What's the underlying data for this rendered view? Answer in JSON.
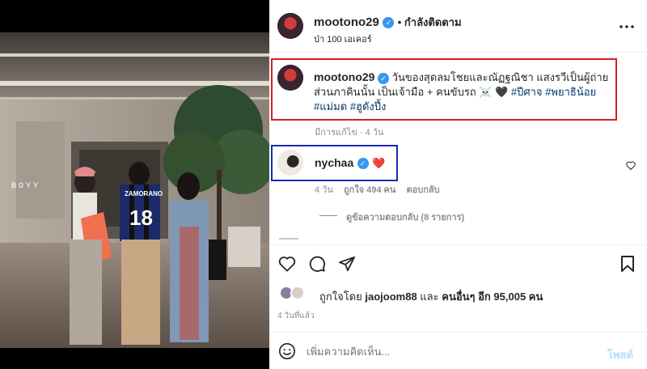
{
  "post": {
    "author": "mootono29",
    "follow_status": "• กำลังติดตาม",
    "location": "ป่า 100 เอเคอร์",
    "more_icon": "more-horizontal-icon",
    "watermark_left": "BOYY",
    "jersey_name": "ZAMORANO",
    "jersey_number": "18"
  },
  "caption": {
    "author": "mootono29",
    "text_before": "วันของสุดลมโชยและณัฏฐณิชา แสงรวีเป็นผู้ถ่ายส่วนภาคินนั้น เป็นเจ้ามือ + คนขับรถ ☠️ 🖤",
    "hashtags": [
      "#ปีศาจ",
      "#พยาธิน้อย",
      "#แม่มด",
      "#ฮูดังปึ้ง"
    ],
    "edited": "มีการแก้ไข · 4 วัน"
  },
  "comment": {
    "author": "nychaa",
    "text": "❤️",
    "time": "4 วัน",
    "likes": "ถูกใจ 494 คน",
    "reply": "ตอบกลับ",
    "view_replies": "ดูข้อความตอบกลับ (8 รายการ)"
  },
  "actions": {
    "like_icon": "heart-icon",
    "comment_icon": "comment-icon",
    "share_icon": "send-icon",
    "save_icon": "bookmark-icon"
  },
  "likes": {
    "prefix": "ถูกใจโดย",
    "user": "jaojoom88",
    "middle": "และ",
    "others": "คนอื่นๆ อีก 95,005 คน",
    "time": "4 วันที่แล้ว"
  },
  "composer": {
    "placeholder": "เพิ่มความคิดเห็น...",
    "post_label": "โพสต์",
    "emoji_icon": "emoji-icon"
  },
  "colors": {
    "verified": "#3897f0",
    "hashtag": "#00376b",
    "red_box": "#d42020",
    "blue_box": "#1a28b8",
    "post_button": "#b2dffc"
  }
}
